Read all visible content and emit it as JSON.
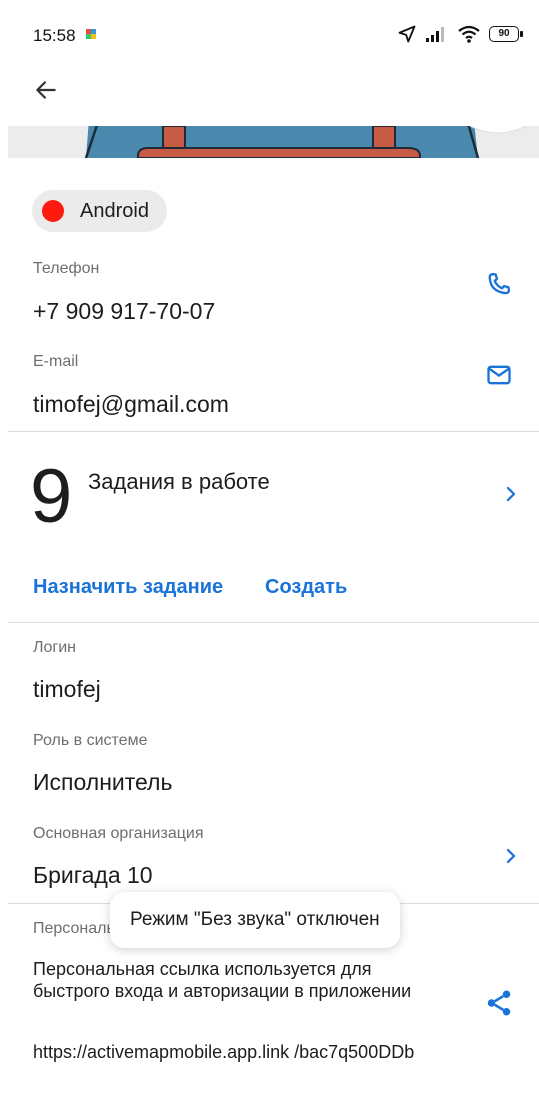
{
  "status_bar": {
    "time": "15:58",
    "battery": "90"
  },
  "chip": {
    "label": "Android",
    "color": "#ff1a10"
  },
  "phone": {
    "label": "Телефон",
    "value": "+7 909 917-70-07"
  },
  "email": {
    "label": "E-mail",
    "value": "timofej@gmail.com"
  },
  "tasks": {
    "count": "9",
    "text": "Задания в работе"
  },
  "actions": {
    "assign": "Назначить задание",
    "create": "Создать"
  },
  "login": {
    "label": "Логин",
    "value": "timofej"
  },
  "role": {
    "label": "Роль в системе",
    "value": "Исполнитель"
  },
  "organization": {
    "label": "Основная организация",
    "value": "Бригада 10"
  },
  "personal_link": {
    "label": "Персональная ссылка",
    "description": "Персональная ссылка используется для быстрого входа и авторизации в приложении",
    "url": "https://activemapmobile.app.link /bac7q500DDb"
  },
  "toast": {
    "text": "Режим \"Без звука\" отключен"
  },
  "colors": {
    "accent": "#1a73d9",
    "status_dot": "#ff1a10"
  },
  "icons": [
    "back-arrow-icon",
    "phone-icon",
    "mail-icon",
    "chevron-right-icon",
    "share-icon",
    "location-arrow-icon",
    "signal-icon",
    "wifi-icon",
    "battery-icon"
  ]
}
